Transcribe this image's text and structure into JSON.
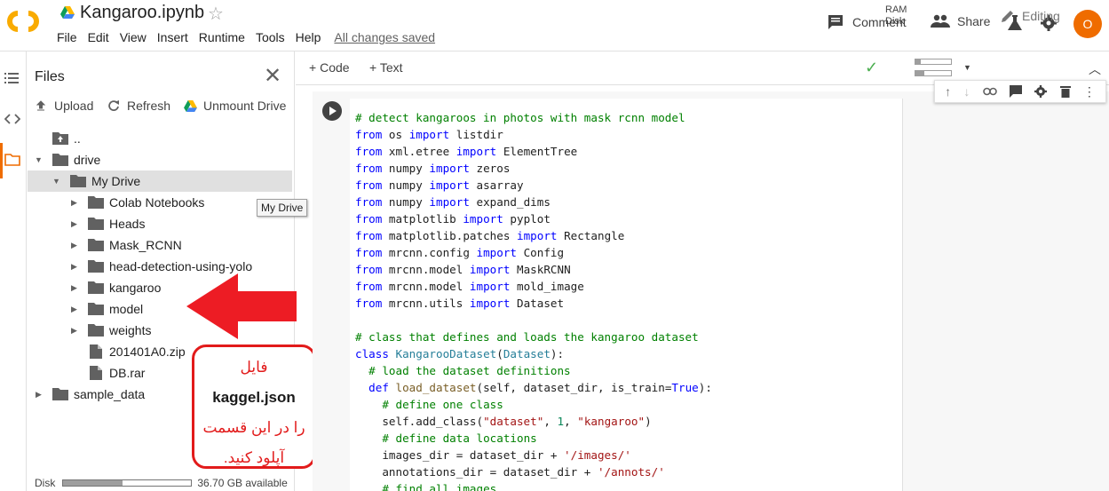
{
  "app": {
    "notebook_title": "Kangaroo.ipynb",
    "menu": [
      "File",
      "Edit",
      "View",
      "Insert",
      "Runtime",
      "Tools",
      "Help"
    ],
    "save_status": "All changes saved",
    "comment_label": "Comment",
    "share_label": "Share",
    "avatar_initial": "O",
    "accent_color": "#ef6c00"
  },
  "files_panel": {
    "title": "Files",
    "toolbar": {
      "upload": "Upload",
      "refresh": "Refresh",
      "unmount": "Unmount Drive"
    },
    "tree": [
      {
        "label": "..",
        "type": "up",
        "depth": 1
      },
      {
        "label": "drive",
        "type": "folder",
        "depth": 0,
        "expanded": true
      },
      {
        "label": "My Drive",
        "type": "folder",
        "depth": 1,
        "expanded": true,
        "selected": true
      },
      {
        "label": "Colab Notebooks",
        "type": "folder",
        "depth": 2
      },
      {
        "label": "Heads",
        "type": "folder",
        "depth": 2
      },
      {
        "label": "Mask_RCNN",
        "type": "folder",
        "depth": 2
      },
      {
        "label": "head-detection-using-yolo",
        "type": "folder",
        "depth": 2
      },
      {
        "label": "kangaroo",
        "type": "folder",
        "depth": 2
      },
      {
        "label": "model",
        "type": "folder",
        "depth": 2
      },
      {
        "label": "weights",
        "type": "folder",
        "depth": 2
      },
      {
        "label": "201401A0.zip",
        "type": "file",
        "depth": 2
      },
      {
        "label": "DB.rar",
        "type": "file",
        "depth": 2
      },
      {
        "label": "sample_data",
        "type": "folder",
        "depth": 0
      }
    ],
    "tooltip": "My Drive",
    "disk_label": "Disk",
    "disk_available": "36.70 GB available",
    "disk_used_fraction": 0.46
  },
  "annotation": {
    "line1_bold": "kaggel.json",
    "line1_prefix": "فایل",
    "line2": "را در این قسمت",
    "line3": "آپلود کنید."
  },
  "notebook_toolbar": {
    "add_code": "Code",
    "add_text": "Text",
    "ram_label": "RAM",
    "disk_label": "Disk",
    "ram_fraction": 0.15,
    "disk_fraction": 0.25,
    "editing_label": "Editing"
  },
  "code_lines": [
    [
      [
        "cm",
        "# detect kangaroos in photos with mask rcnn model"
      ]
    ],
    [
      [
        "kw",
        "from"
      ],
      [
        "",
        " os "
      ],
      [
        "kw",
        "import"
      ],
      [
        "",
        " listdir"
      ]
    ],
    [
      [
        "kw",
        "from"
      ],
      [
        "",
        " xml.etree "
      ],
      [
        "kw",
        "import"
      ],
      [
        "",
        " ElementTree"
      ]
    ],
    [
      [
        "kw",
        "from"
      ],
      [
        "",
        " numpy "
      ],
      [
        "kw",
        "import"
      ],
      [
        "",
        " zeros"
      ]
    ],
    [
      [
        "kw",
        "from"
      ],
      [
        "",
        " numpy "
      ],
      [
        "kw",
        "import"
      ],
      [
        "",
        " asarray"
      ]
    ],
    [
      [
        "kw",
        "from"
      ],
      [
        "",
        " numpy "
      ],
      [
        "kw",
        "import"
      ],
      [
        "",
        " expand_dims"
      ]
    ],
    [
      [
        "kw",
        "from"
      ],
      [
        "",
        " matplotlib "
      ],
      [
        "kw",
        "import"
      ],
      [
        "",
        " pyplot"
      ]
    ],
    [
      [
        "kw",
        "from"
      ],
      [
        "",
        " matplotlib.patches "
      ],
      [
        "kw",
        "import"
      ],
      [
        "",
        " Rectangle"
      ]
    ],
    [
      [
        "kw",
        "from"
      ],
      [
        "",
        " mrcnn.config "
      ],
      [
        "kw",
        "import"
      ],
      [
        "",
        " Config"
      ]
    ],
    [
      [
        "kw",
        "from"
      ],
      [
        "",
        " mrcnn.model "
      ],
      [
        "kw",
        "import"
      ],
      [
        "",
        " MaskRCNN"
      ]
    ],
    [
      [
        "kw",
        "from"
      ],
      [
        "",
        " mrcnn.model "
      ],
      [
        "kw",
        "import"
      ],
      [
        "",
        " mold_image"
      ]
    ],
    [
      [
        "kw",
        "from"
      ],
      [
        "",
        " mrcnn.utils "
      ],
      [
        "kw",
        "import"
      ],
      [
        "",
        " Dataset"
      ]
    ],
    [
      [
        "",
        ""
      ]
    ],
    [
      [
        "cm",
        "# class that defines and loads the kangaroo dataset"
      ]
    ],
    [
      [
        "kw",
        "class"
      ],
      [
        "",
        " "
      ],
      [
        "cls",
        "KangarooDataset"
      ],
      [
        "",
        "("
      ],
      [
        "cls",
        "Dataset"
      ],
      [
        "",
        "):"
      ]
    ],
    [
      [
        "",
        "  "
      ],
      [
        "cm",
        "# load the dataset definitions"
      ]
    ],
    [
      [
        "",
        "  "
      ],
      [
        "kw",
        "def"
      ],
      [
        "",
        " "
      ],
      [
        "fn",
        "load_dataset"
      ],
      [
        "",
        "(self, dataset_dir, is_train="
      ],
      [
        "kw",
        "True"
      ],
      [
        "",
        "):"
      ]
    ],
    [
      [
        "",
        "    "
      ],
      [
        "cm",
        "# define one class"
      ]
    ],
    [
      [
        "",
        "    self.add_class("
      ],
      [
        "str",
        "\"dataset\""
      ],
      [
        "",
        ", "
      ],
      [
        "num",
        "1"
      ],
      [
        "",
        ", "
      ],
      [
        "str",
        "\"kangaroo\""
      ],
      [
        "",
        ")"
      ]
    ],
    [
      [
        "",
        "    "
      ],
      [
        "cm",
        "# define data locations"
      ]
    ],
    [
      [
        "",
        "    images_dir = dataset_dir + "
      ],
      [
        "str",
        "'/images/'"
      ]
    ],
    [
      [
        "",
        "    annotations_dir = dataset_dir + "
      ],
      [
        "str",
        "'/annots/'"
      ]
    ],
    [
      [
        "",
        "    "
      ],
      [
        "cm",
        "# find all images"
      ]
    ]
  ]
}
